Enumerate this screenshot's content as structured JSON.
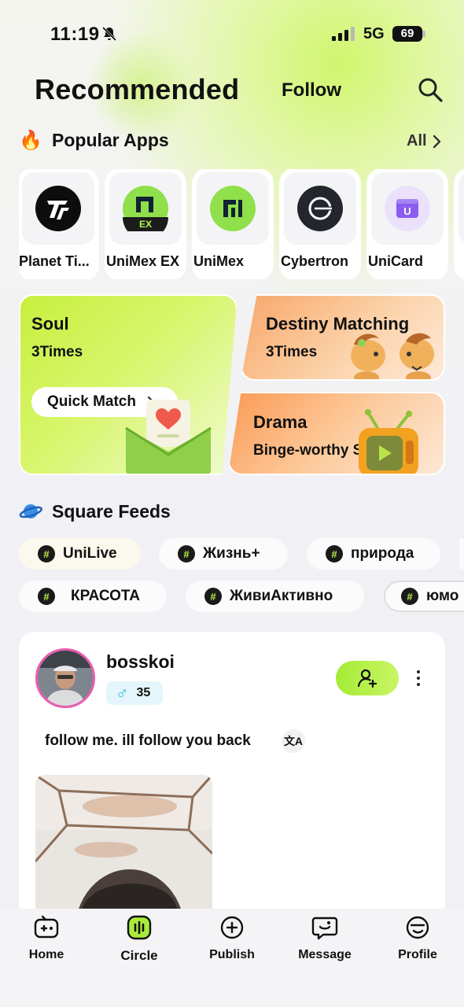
{
  "status_bar": {
    "time": "11:19",
    "network": "5G",
    "battery": "69"
  },
  "header": {
    "title": "Recommended",
    "follow_tab": "Follow"
  },
  "popular_apps": {
    "title": "Popular Apps",
    "all_label": "All",
    "apps": [
      {
        "name": "Planet Ti...",
        "icon": "planet-tiles-logo"
      },
      {
        "name": "UniMex EX",
        "icon": "unimex-ex-logo",
        "icon_text": "EX"
      },
      {
        "name": "UniMex",
        "icon": "unimex-logo"
      },
      {
        "name": "Cybertron",
        "icon": "cybertron-logo"
      },
      {
        "name": "UniCard",
        "icon": "unicard-logo",
        "icon_text": "U"
      }
    ]
  },
  "promos": {
    "soul": {
      "title": "Soul",
      "subtitle": "3Times",
      "button": "Quick Match"
    },
    "destiny": {
      "title": "Destiny Matching",
      "subtitle": "3Times"
    },
    "drama": {
      "title": "Drama",
      "subtitle": "Binge-worthy Shows"
    }
  },
  "square_feeds": {
    "title": "Square Feeds",
    "tags_row1": [
      "UniLive",
      "Жизнь+",
      "природа",
      ""
    ],
    "tags_row2": [
      "КРАСОТА",
      "ЖивиАктивно",
      "юмо"
    ]
  },
  "post": {
    "username": "bosskoi",
    "gender_symbol": "♂",
    "age": "35",
    "text": "follow me. ill follow you back",
    "translate_glyph": "文A"
  },
  "tab_bar": {
    "items": [
      {
        "label": "Home",
        "icon": "home-game-icon"
      },
      {
        "label": "Circle",
        "icon": "circle-icon",
        "active": true
      },
      {
        "label": "Publish",
        "icon": "plus-circle-icon"
      },
      {
        "label": "Message",
        "icon": "message-icon"
      },
      {
        "label": "Profile",
        "icon": "profile-face-icon"
      }
    ]
  },
  "colors": {
    "accent_green": "#b8f34a",
    "text": "#111111",
    "background": "#f1f1f5",
    "avatar_ring": "#ec5bb0"
  }
}
